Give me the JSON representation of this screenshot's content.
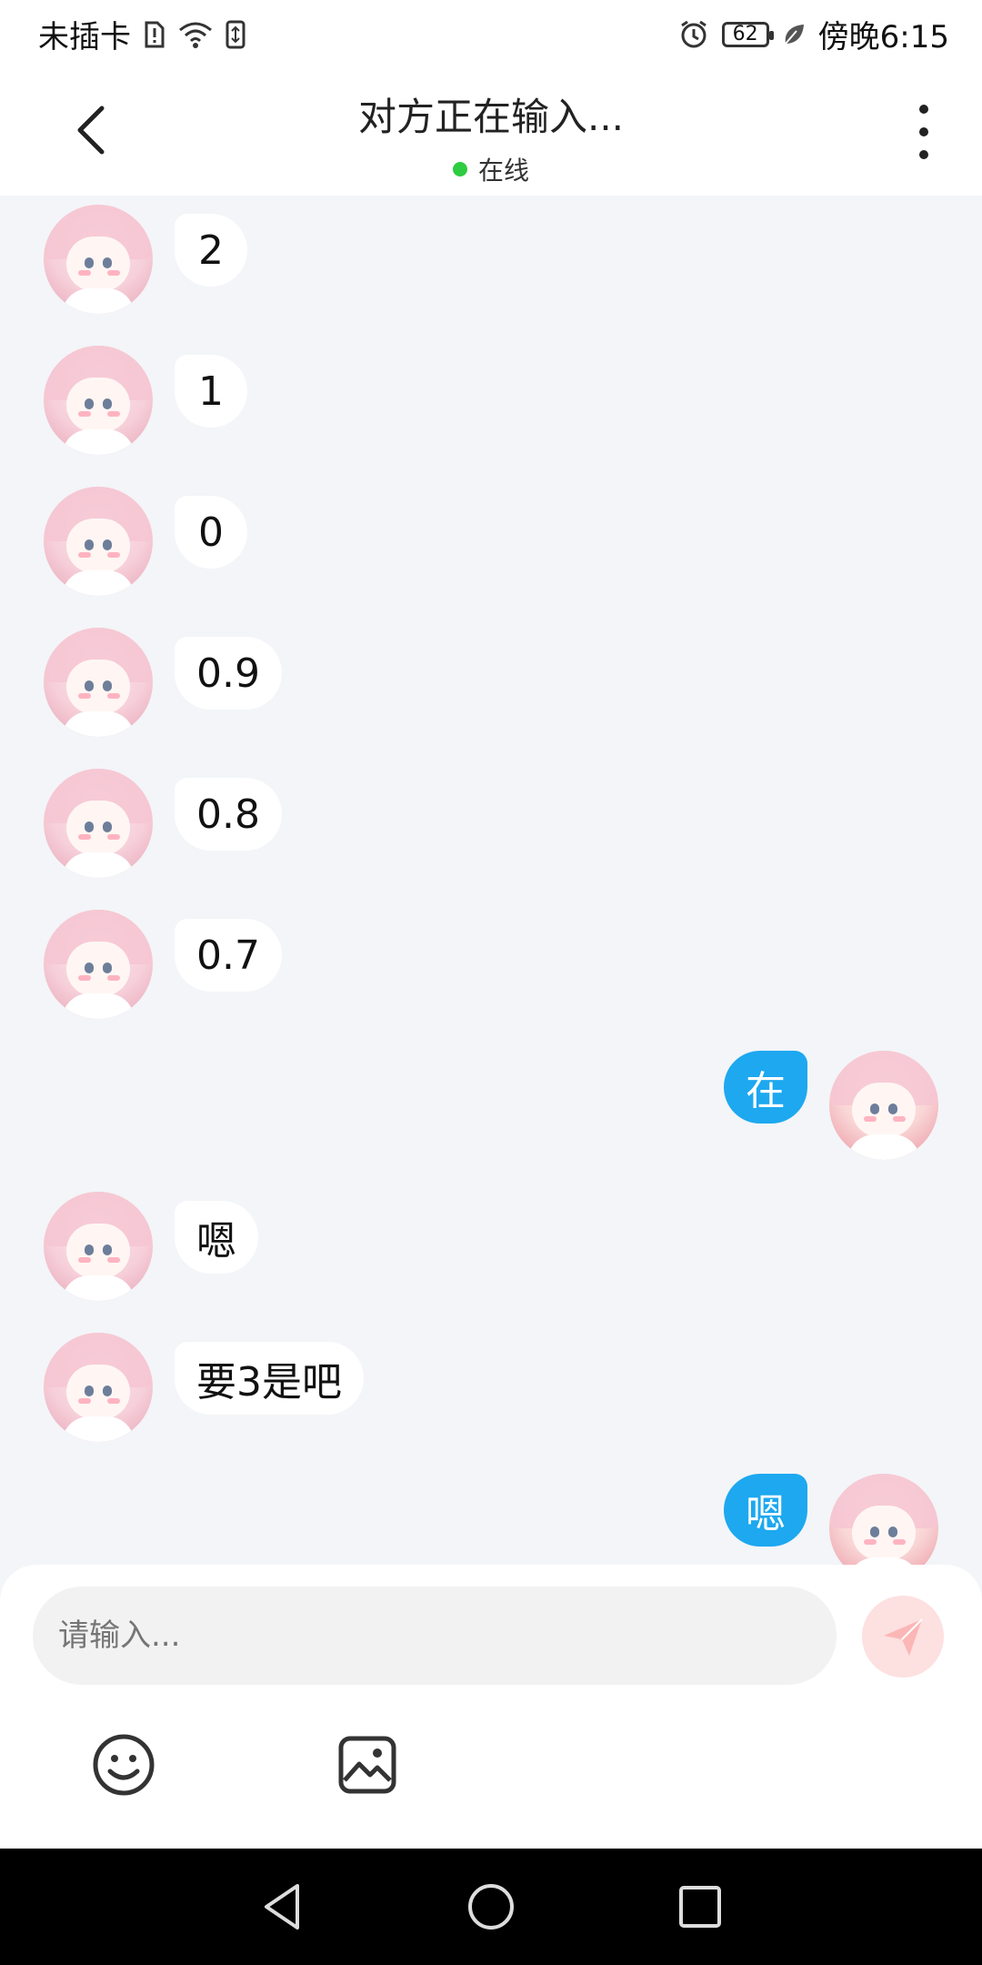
{
  "status_bar": {
    "carrier": "未插卡",
    "battery": "62",
    "time": "傍晚6:15",
    "icons": [
      "sim-missing-icon",
      "wifi-icon",
      "data-transfer-icon",
      "alarm-icon",
      "battery-icon",
      "leaf-icon"
    ]
  },
  "header": {
    "title": "对方正在输入...",
    "presence": "在线",
    "presence_color": "#2ecc40",
    "back_icon": "chevron-left-icon",
    "more_icon": "more-vertical-icon"
  },
  "messages": [
    {
      "direction": "in",
      "text": "2"
    },
    {
      "direction": "in",
      "text": "1"
    },
    {
      "direction": "in",
      "text": "0"
    },
    {
      "direction": "in",
      "text": "0.9"
    },
    {
      "direction": "in",
      "text": "0.8"
    },
    {
      "direction": "in",
      "text": "0.7"
    },
    {
      "direction": "out",
      "text": "在"
    },
    {
      "direction": "in",
      "text": "嗯"
    },
    {
      "direction": "in",
      "text": "要3是吧"
    },
    {
      "direction": "out",
      "text": "嗯"
    }
  ],
  "composer": {
    "placeholder": "请输入...",
    "send_icon": "send-icon",
    "tools": [
      "emoji-icon",
      "image-icon"
    ]
  },
  "colors": {
    "outgoing_bubble": "#1da8f0",
    "incoming_bubble": "#ffffff",
    "chat_background": "#f3f5f8",
    "send_button": "#fde0e0"
  },
  "nav_bar": {
    "icons": [
      "nav-back-icon",
      "nav-home-icon",
      "nav-recent-icon"
    ]
  }
}
